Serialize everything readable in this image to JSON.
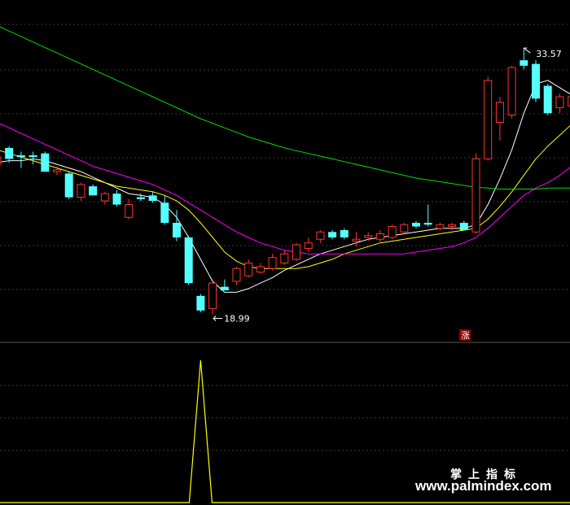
{
  "chart_data": {
    "type": "candlestick",
    "y_label_high": "33.57",
    "y_label_low": "18.99",
    "badge": "涨",
    "y_range": [
      17.5,
      36.2
    ],
    "candles": [
      {
        "o": 27.6,
        "h": 27.9,
        "l": 26.8,
        "c": 27.2,
        "up": true
      },
      {
        "o": 28.1,
        "h": 28.2,
        "l": 27.3,
        "c": 27.5,
        "up": false
      },
      {
        "o": 27.7,
        "h": 27.9,
        "l": 27.0,
        "c": 27.6,
        "up": false
      },
      {
        "o": 27.7,
        "h": 27.9,
        "l": 27.2,
        "c": 27.6,
        "up": false
      },
      {
        "o": 27.8,
        "h": 27.9,
        "l": 26.8,
        "c": 26.8,
        "up": false
      },
      {
        "o": 26.8,
        "h": 27.1,
        "l": 26.6,
        "c": 26.9,
        "up": true
      },
      {
        "o": 26.7,
        "h": 26.8,
        "l": 25.3,
        "c": 25.4,
        "up": false
      },
      {
        "o": 25.4,
        "h": 26.2,
        "l": 25.2,
        "c": 26.1,
        "up": true
      },
      {
        "o": 26.0,
        "h": 26.1,
        "l": 25.5,
        "c": 25.5,
        "up": false
      },
      {
        "o": 25.2,
        "h": 25.7,
        "l": 25.0,
        "c": 25.6,
        "up": true
      },
      {
        "o": 25.6,
        "h": 25.8,
        "l": 24.9,
        "c": 25.0,
        "up": false
      },
      {
        "o": 24.3,
        "h": 25.3,
        "l": 24.2,
        "c": 25.0,
        "up": true
      },
      {
        "o": 25.4,
        "h": 25.6,
        "l": 25.2,
        "c": 25.3,
        "up": false
      },
      {
        "o": 25.5,
        "h": 25.7,
        "l": 25.1,
        "c": 25.2,
        "up": false
      },
      {
        "o": 25.1,
        "h": 25.5,
        "l": 23.9,
        "c": 24.0,
        "up": false
      },
      {
        "o": 24.0,
        "h": 24.7,
        "l": 23.0,
        "c": 23.2,
        "up": false
      },
      {
        "o": 23.2,
        "h": 23.3,
        "l": 20.6,
        "c": 20.7,
        "up": false
      },
      {
        "o": 20.0,
        "h": 20.1,
        "l": 19.1,
        "c": 19.2,
        "up": false
      },
      {
        "o": 19.3,
        "h": 20.8,
        "l": 18.99,
        "c": 20.7,
        "up": true
      },
      {
        "o": 20.5,
        "h": 20.9,
        "l": 20.3,
        "c": 20.3,
        "up": false
      },
      {
        "o": 20.8,
        "h": 21.6,
        "l": 20.6,
        "c": 21.5,
        "up": true
      },
      {
        "o": 21.1,
        "h": 22.0,
        "l": 21.0,
        "c": 21.8,
        "up": true
      },
      {
        "o": 21.3,
        "h": 21.8,
        "l": 21.2,
        "c": 21.6,
        "up": true
      },
      {
        "o": 21.5,
        "h": 22.3,
        "l": 21.4,
        "c": 22.1,
        "up": true
      },
      {
        "o": 21.8,
        "h": 22.5,
        "l": 21.7,
        "c": 22.3,
        "up": true
      },
      {
        "o": 22.0,
        "h": 22.9,
        "l": 21.9,
        "c": 22.8,
        "up": true
      },
      {
        "o": 22.6,
        "h": 23.2,
        "l": 22.4,
        "c": 22.9,
        "up": true
      },
      {
        "o": 23.1,
        "h": 23.6,
        "l": 22.9,
        "c": 23.5,
        "up": true
      },
      {
        "o": 23.5,
        "h": 23.6,
        "l": 23.1,
        "c": 23.2,
        "up": false
      },
      {
        "o": 23.6,
        "h": 23.7,
        "l": 23.1,
        "c": 23.2,
        "up": false
      },
      {
        "o": 23.0,
        "h": 23.5,
        "l": 22.7,
        "c": 23.1,
        "up": true
      },
      {
        "o": 23.2,
        "h": 23.5,
        "l": 23.0,
        "c": 23.3,
        "up": true
      },
      {
        "o": 23.1,
        "h": 23.6,
        "l": 22.9,
        "c": 23.4,
        "up": true
      },
      {
        "o": 23.2,
        "h": 23.9,
        "l": 23.1,
        "c": 23.8,
        "up": true
      },
      {
        "o": 23.5,
        "h": 24.0,
        "l": 23.4,
        "c": 23.9,
        "up": true
      },
      {
        "o": 24.0,
        "h": 24.1,
        "l": 23.7,
        "c": 23.8,
        "up": false
      },
      {
        "o": 23.9,
        "h": 25.0,
        "l": 23.8,
        "c": 24.0,
        "up": false
      },
      {
        "o": 23.7,
        "h": 24.0,
        "l": 23.6,
        "c": 23.9,
        "up": true
      },
      {
        "o": 23.8,
        "h": 24.0,
        "l": 23.6,
        "c": 23.9,
        "up": true
      },
      {
        "o": 24.0,
        "h": 24.1,
        "l": 23.6,
        "c": 23.6,
        "up": false
      },
      {
        "o": 23.5,
        "h": 27.8,
        "l": 23.4,
        "c": 27.5,
        "up": true
      },
      {
        "o": 27.5,
        "h": 32.0,
        "l": 27.4,
        "c": 31.8,
        "up": true
      },
      {
        "o": 29.5,
        "h": 30.9,
        "l": 28.5,
        "c": 30.6,
        "up": true
      },
      {
        "o": 29.9,
        "h": 32.6,
        "l": 29.7,
        "c": 32.5,
        "up": true
      },
      {
        "o": 32.6,
        "h": 33.57,
        "l": 32.4,
        "c": 32.9,
        "up": false
      },
      {
        "o": 32.7,
        "h": 32.9,
        "l": 30.6,
        "c": 30.8,
        "up": false
      },
      {
        "o": 31.5,
        "h": 31.6,
        "l": 29.9,
        "c": 30.0,
        "up": false
      },
      {
        "o": 30.3,
        "h": 31.1,
        "l": 30.0,
        "c": 30.9,
        "up": true
      },
      {
        "o": 30.4,
        "h": 31.1,
        "l": 30.3,
        "c": 30.9,
        "up": true
      },
      {
        "o": 30.4,
        "h": 30.8,
        "l": 29.8,
        "c": 30.0,
        "up": false
      }
    ],
    "ma": [
      {
        "color": "#ffffff",
        "values": [
          27.3,
          27.4,
          27.4,
          27.5,
          27.4,
          27.2,
          27.0,
          26.8,
          26.5,
          26.2,
          25.9,
          25.6,
          25.5,
          25.4,
          25.0,
          24.3,
          23.2,
          22.0,
          20.8,
          20.2,
          20.2,
          20.4,
          20.7,
          21.0,
          21.4,
          21.7,
          22.0,
          22.3,
          22.5,
          22.7,
          22.9,
          23.1,
          23.2,
          23.3,
          23.4,
          23.5,
          23.6,
          23.7,
          23.7,
          23.7,
          23.9,
          25.0,
          26.4,
          28.0,
          30.0,
          31.6,
          31.8,
          31.4,
          31.0,
          30.8
        ]
      },
      {
        "color": "#ffff00",
        "values": [
          28.0,
          27.8,
          27.6,
          27.4,
          27.2,
          27.0,
          26.8,
          26.6,
          26.4,
          26.2,
          26.0,
          25.9,
          25.8,
          25.7,
          25.5,
          25.2,
          24.7,
          24.0,
          23.2,
          22.4,
          21.9,
          21.6,
          21.5,
          21.5,
          21.5,
          21.5,
          21.6,
          21.8,
          22.0,
          22.3,
          22.5,
          22.7,
          22.9,
          23.0,
          23.1,
          23.2,
          23.3,
          23.4,
          23.5,
          23.6,
          23.7,
          24.2,
          24.9,
          25.7,
          26.6,
          27.5,
          28.2,
          28.8,
          29.4,
          30.0
        ]
      },
      {
        "color": "#ff00ff",
        "values": [
          29.5,
          29.2,
          28.9,
          28.6,
          28.3,
          28.0,
          27.7,
          27.4,
          27.1,
          26.9,
          26.7,
          26.5,
          26.3,
          26.1,
          25.8,
          25.5,
          25.1,
          24.7,
          24.3,
          23.9,
          23.5,
          23.2,
          22.9,
          22.7,
          22.5,
          22.4,
          22.3,
          22.3,
          22.3,
          22.3,
          22.3,
          22.3,
          22.3,
          22.3,
          22.3,
          22.4,
          22.5,
          22.6,
          22.7,
          22.9,
          23.2,
          23.7,
          24.3,
          24.9,
          25.5,
          25.9,
          26.2,
          26.6,
          27.1,
          27.7
        ]
      },
      {
        "color": "#00dd00",
        "values": [
          34.8,
          34.5,
          34.2,
          33.9,
          33.6,
          33.3,
          33.0,
          32.7,
          32.4,
          32.1,
          31.8,
          31.5,
          31.2,
          30.9,
          30.6,
          30.3,
          30.0,
          29.7,
          29.45,
          29.2,
          28.95,
          28.7,
          28.5,
          28.3,
          28.1,
          27.95,
          27.8,
          27.65,
          27.5,
          27.35,
          27.2,
          27.05,
          26.9,
          26.75,
          26.6,
          26.45,
          26.35,
          26.25,
          26.15,
          26.05,
          25.95,
          25.9,
          25.85,
          25.85,
          25.85,
          25.85,
          25.9,
          25.9,
          25.9,
          25.9
        ]
      }
    ],
    "indicator": {
      "color": "#ffff00",
      "spike_index": 17,
      "values": [
        0,
        0,
        0,
        0,
        0,
        0,
        0,
        0,
        0,
        0,
        0,
        0,
        0,
        0,
        0,
        0,
        0,
        1,
        0,
        0,
        0,
        0,
        0,
        0,
        0,
        0,
        0,
        0,
        0,
        0,
        0,
        0,
        0,
        0,
        0,
        0,
        0,
        0,
        0,
        0,
        0,
        0,
        0,
        0,
        0,
        0,
        0,
        0,
        0,
        0
      ]
    },
    "colors": {
      "up": "#ff3232",
      "down": "#54ffff",
      "grid": "#393939",
      "divider": "#555555",
      "label": "#ffffff",
      "badge_bg": "#8b0000"
    }
  },
  "watermark": {
    "cn": "掌上指标",
    "url": "www.palmindex.com"
  }
}
